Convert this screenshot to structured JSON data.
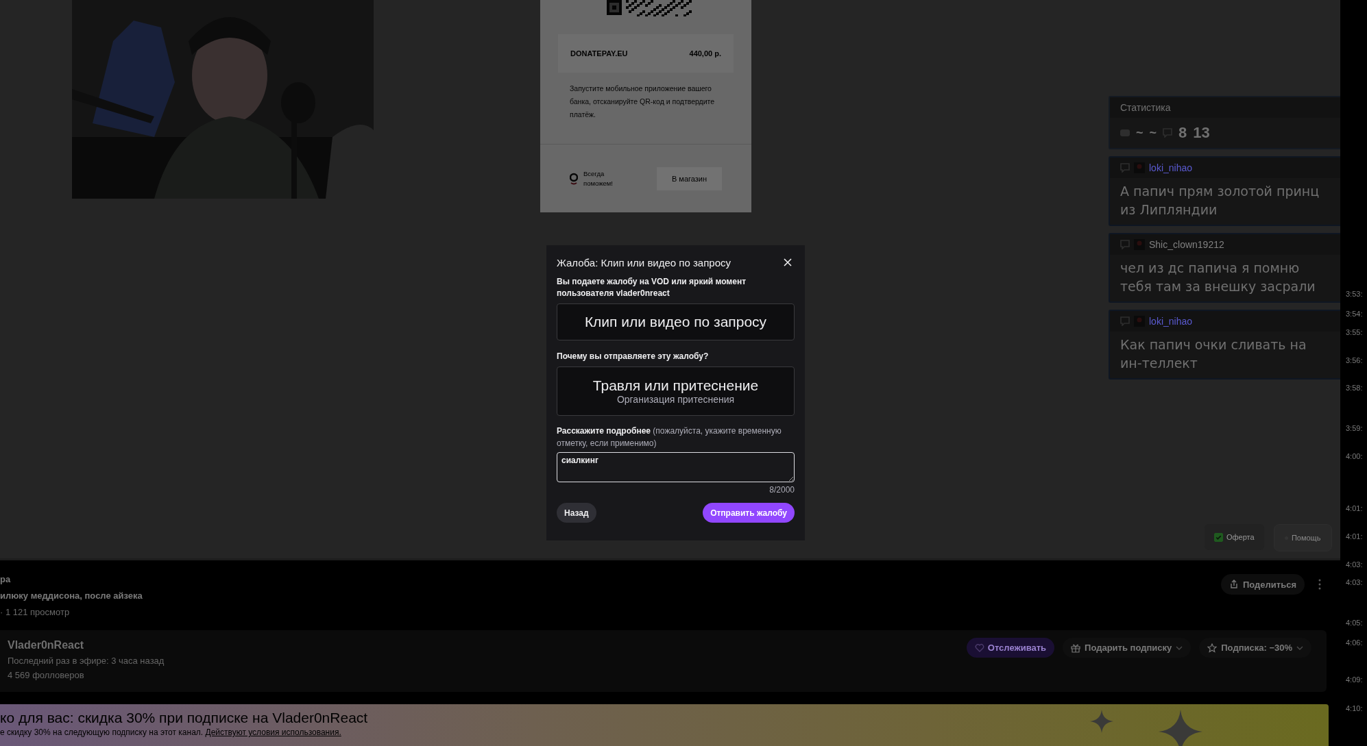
{
  "stream_overlay": {
    "donation": {
      "service": "DONATEPAY.EU",
      "amount": "440,00 р.",
      "instruction": "Запустите мобильное приложение вашего банка, отсканируйте QR-код и подтвердите платёж.",
      "support_text": "Всегда поможем!",
      "shop_button": "В магазин"
    },
    "chat_widget": {
      "title": "Статистика",
      "stats": [
        "~",
        "~",
        "8",
        "13"
      ],
      "messages": [
        {
          "user": "loki_nihao",
          "color": "#5a5ad0",
          "text": "А папич прям золотой принц из Липляндии"
        },
        {
          "user": "Shic_clown19212",
          "color": "#808080",
          "text": "чел из дс папича я помню тебя там за внешку засрали"
        },
        {
          "user": "loki_nihao",
          "color": "#5a5ad0",
          "text": "Как папич очки сливать на ин-теллект"
        }
      ]
    },
    "offer": {
      "label": "Оферта",
      "checked": true
    },
    "help_button": "Помощь"
  },
  "modal": {
    "title": "Жалоба: Клип или видео по запросу",
    "intro": "Вы подаете жалобу на VOD или яркий момент пользователя vlader0nreact",
    "content_choice": "Клип или видео по запросу",
    "reason_label": "Почему вы отправляете эту жалобу?",
    "reason": {
      "title": "Травля или притеснение",
      "subtitle": "Организация притеснения"
    },
    "details_label": "**Расскажите подробнее** (пожалуйста, укажите временную отметку, если применимо)",
    "details_value": "сиалкинг",
    "counter": "8/2000",
    "back_button": "Назад",
    "submit_button": "Отправить жалобу"
  },
  "video_info": {
    "title": "ра",
    "subtitle": "илюку меддисона, после айзека",
    "meta": "· 1 121 просмотр",
    "share_button": "Поделиться"
  },
  "channel": {
    "name": "Vlader0nReact",
    "last_live": "Последний раз в эфире: 3 часа назад",
    "followers": "4 569 фолловеров",
    "follow_button": "Отслеживать",
    "gift_button": "Подарить подписку",
    "subscribe_button": "Подписка: −30%"
  },
  "promo": {
    "title": "ко для вас: скидка 30% при подписке на Vlader0nReact",
    "text": "е скидку 30% на следующую подписку на этот канал.",
    "link": "Действуют условия использования."
  },
  "chat_timestamps": [
    "3:53:",
    "3:54:",
    "3:55:",
    "3:56:",
    "3:58:",
    "3:59:",
    "4:00:",
    "4:01:",
    "4:01:",
    "4:03:",
    "4:03:",
    "4:05:",
    "4:06:",
    "4:09:",
    "4:10:"
  ]
}
